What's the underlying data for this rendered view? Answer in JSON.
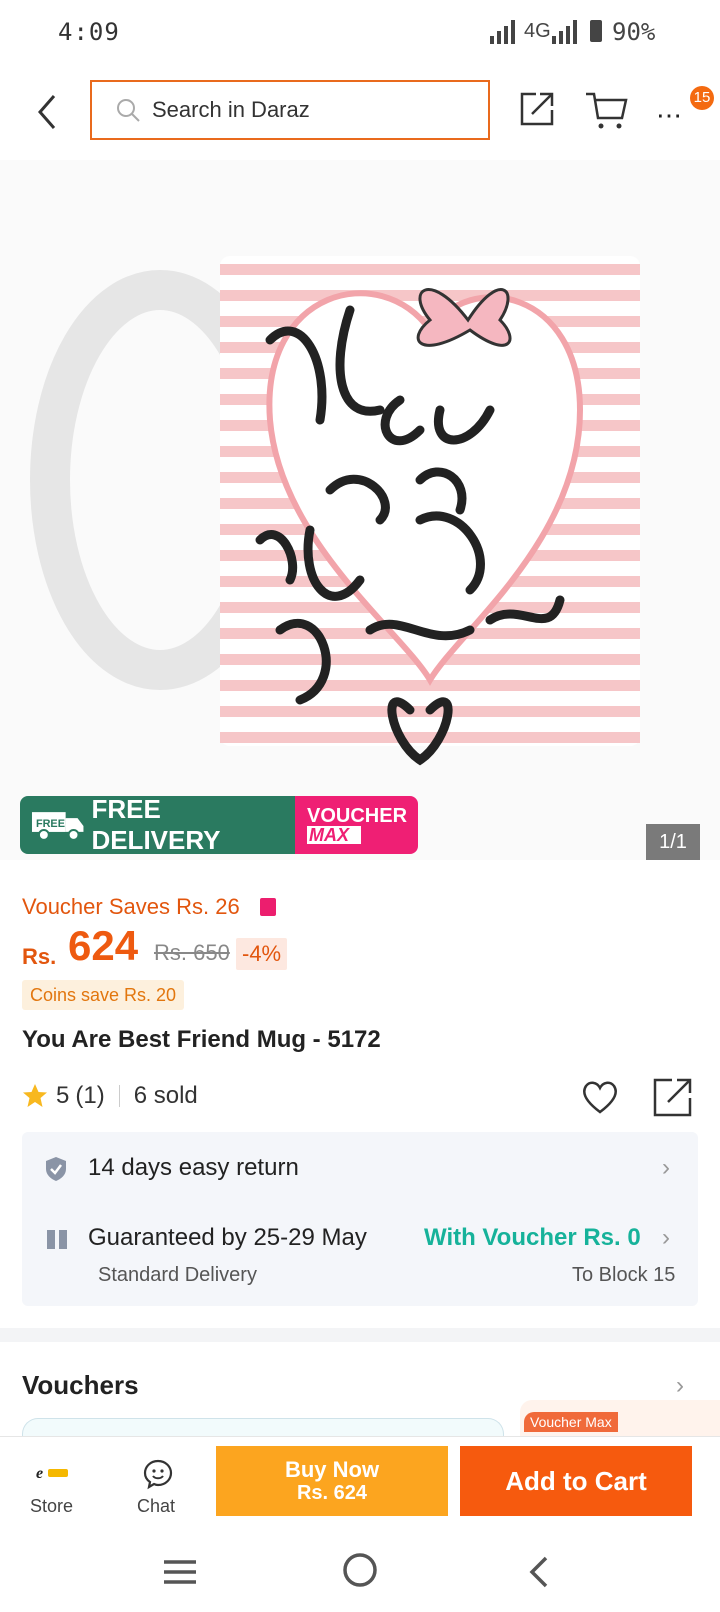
{
  "status_bar": {
    "time": "4:09",
    "network": "4G",
    "battery": "90%"
  },
  "header": {
    "search_placeholder": "Search in Daraz",
    "cart_badge": "15"
  },
  "gallery": {
    "counter": "1/1",
    "badge_free": "FREE",
    "badge_free_delivery": "FREE DELIVERY",
    "badge_voucher": "VOUCHER",
    "badge_max": "MAX"
  },
  "product": {
    "voucher_saves": "Voucher Saves Rs. 26",
    "currency": "Rs.",
    "price": "624",
    "original_price": "Rs. 650",
    "discount": "-4%",
    "coins_save": "Coins save Rs. 20",
    "title": "You Are Best Friend Mug - 5172",
    "rating": "5",
    "rating_count": "(1)",
    "sold": "6 sold"
  },
  "service": {
    "return_text": "14 days easy return",
    "guarantee_text": "Guaranteed by 25-29 May",
    "voucher_delivery": "With Voucher Rs. 0",
    "delivery_type": "Standard Delivery",
    "delivery_to": "To Block 15"
  },
  "vouchers": {
    "title": "Vouchers",
    "card_label": "Voucher Max"
  },
  "bottom_bar": {
    "store_label": "Store",
    "chat_label": "Chat",
    "buy_now_label": "Buy Now",
    "buy_now_price": "Rs. 624",
    "add_to_cart_label": "Add to Cart"
  },
  "colors": {
    "brand_orange": "#f65a0e",
    "buy_yellow": "#fca51f",
    "teal": "#16b29a",
    "delivery_green": "#2a7a60",
    "voucher_pink": "#ef1f74"
  }
}
